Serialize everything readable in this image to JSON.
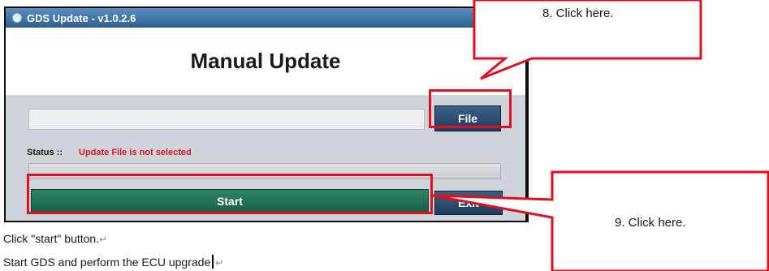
{
  "window": {
    "title": "GDS Update - v1.0.2.6",
    "heading": "Manual Update",
    "file_path_value": "",
    "file_button_label": "File",
    "status_label": "Status ::",
    "status_value": "Update File is not selected",
    "progress_percent": 0,
    "start_button_label": "Start",
    "exit_button_label": "Exit"
  },
  "callouts": [
    {
      "text": "8. Click here."
    },
    {
      "text": "9. Click here."
    }
  ],
  "document": {
    "line1": "Click \"start\" button.",
    "line2": "Start GDS and perform the ECU upgrade",
    "paragraph_mark": "↵"
  },
  "colors": {
    "highlight": "#e0101e",
    "status_error": "#e0162b",
    "start_button": "#1f6f55",
    "file_button": "#2a4a70"
  }
}
